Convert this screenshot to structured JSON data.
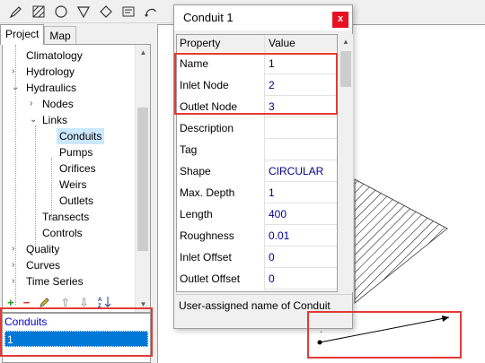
{
  "toolbar": {
    "icons": [
      "pencil-icon",
      "hatch-icon",
      "circle-icon",
      "triangle-icon",
      "diamond-icon",
      "label-icon",
      "pipe-icon"
    ]
  },
  "left_panel": {
    "tabs": [
      {
        "label": "Project",
        "active": true
      },
      {
        "label": "Map",
        "active": false
      }
    ],
    "tree": {
      "climatology": "Climatology",
      "hydrology": "Hydrology",
      "hydraulics": "Hydraulics",
      "nodes": "Nodes",
      "links": "Links",
      "conduits": "Conduits",
      "pumps": "Pumps",
      "orifices": "Orifices",
      "weirs": "Weirs",
      "outlets": "Outlets",
      "transects": "Transects",
      "controls": "Controls",
      "quality": "Quality",
      "curves": "Curves",
      "time_series": "Time Series"
    },
    "list": {
      "title": "Conduits",
      "items": [
        "1"
      ]
    }
  },
  "dialog": {
    "title": "Conduit 1",
    "close": "x",
    "columns": {
      "property": "Property",
      "value": "Value"
    },
    "rows": [
      {
        "k": "Name",
        "v": "1"
      },
      {
        "k": "Inlet Node",
        "v": "2"
      },
      {
        "k": "Outlet Node",
        "v": "3"
      },
      {
        "k": "Description",
        "v": ""
      },
      {
        "k": "Tag",
        "v": ""
      },
      {
        "k": "Shape",
        "v": "CIRCULAR"
      },
      {
        "k": "Max. Depth",
        "v": "1"
      },
      {
        "k": "Length",
        "v": "400"
      },
      {
        "k": "Roughness",
        "v": "0.01"
      },
      {
        "k": "Inlet Offset",
        "v": "0"
      },
      {
        "k": "Outlet Offset",
        "v": "0"
      }
    ],
    "status": "User-assigned name of Conduit"
  },
  "colors": {
    "highlight": "#e53935",
    "selection": "#0078d7",
    "value_text": "#00008b"
  }
}
